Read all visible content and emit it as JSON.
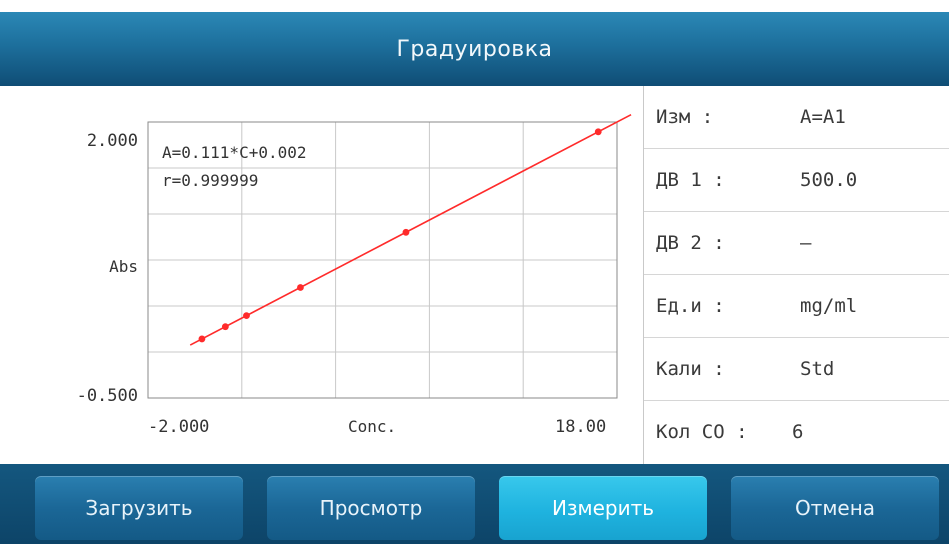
{
  "window": {
    "title": "Градуировка"
  },
  "chart_data": {
    "type": "scatter",
    "equation": "A=0.111*C+0.002",
    "correlation": "r=0.999999",
    "ylabel": "Abs",
    "xlabel": "Conc.",
    "y_tick_top": "2.000",
    "y_tick_bottom": "-0.500",
    "x_tick_left": "-2.000",
    "x_tick_right": "18.00",
    "xlim": [
      -2.0,
      18.0
    ],
    "ylim": [
      -0.5,
      2.0
    ],
    "grid": true,
    "points": [
      {
        "x": 0.3,
        "y": 0.035
      },
      {
        "x": 1.3,
        "y": 0.146
      },
      {
        "x": 2.2,
        "y": 0.246
      },
      {
        "x": 4.5,
        "y": 0.501
      },
      {
        "x": 9.0,
        "y": 1.001
      },
      {
        "x": 17.2,
        "y": 1.911
      }
    ],
    "fit": {
      "slope": 0.111,
      "intercept": 0.002
    },
    "line_color": "#ff2b2b"
  },
  "info": {
    "rows": [
      {
        "label": "Изм :",
        "value": "A=A1"
      },
      {
        "label": "ДВ 1 :",
        "value": "500.0"
      },
      {
        "label": "ДВ 2 :",
        "value": "—"
      },
      {
        "label": "Ед.и :",
        "value": "mg/ml"
      },
      {
        "label": "Кали :",
        "value": "Std"
      },
      {
        "label": "Кол СО :",
        "value": "6"
      }
    ]
  },
  "toolbar": {
    "load_label": "Загрузить",
    "view_label": "Просмотр",
    "measure_label": "Измерить",
    "cancel_label": "Отмена"
  },
  "colors": {
    "title_bar": "#1d6f9c",
    "button": "#1b6797",
    "button_active": "#1fb3df",
    "fit_line": "#ff2b2b"
  }
}
